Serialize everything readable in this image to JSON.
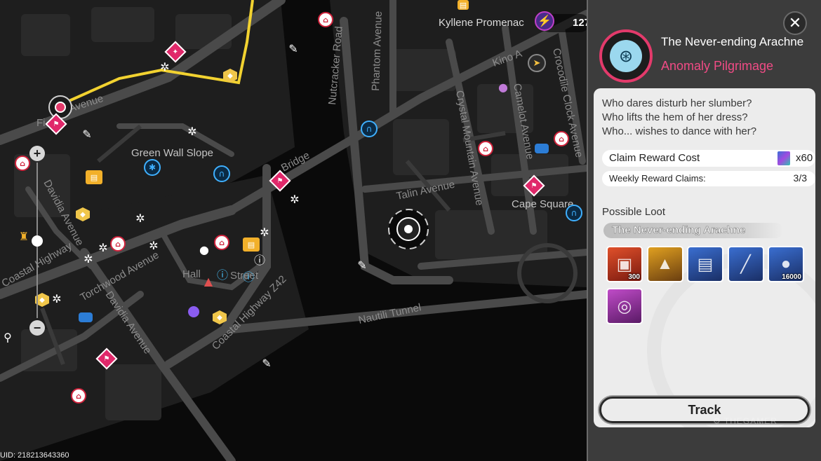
{
  "map": {
    "road_labels": [
      "Fi",
      "Avenue",
      "Nutcracker Road",
      "Phantom Avenue",
      "Kino A",
      "Camelot Avenue",
      "Crocodile Clock Avenue",
      "Crystal Mountain Avenue",
      "Bridge",
      "Talin Avenue",
      "Coastal Highway",
      "Davidia Avenue",
      "Torchwood Avenue",
      "Davidia Avenue",
      "Coastal Highway Z42",
      "Nautili Tunnel",
      "Hall",
      "Street"
    ],
    "area_labels": [
      "Green Wall Slope",
      "Cape Square"
    ],
    "place_label": "Kyllene Promenac",
    "energy_value": "127",
    "uid": "UID: 218213643360",
    "route_color": "#f2d230",
    "accent_color": "#e33a6b"
  },
  "panel": {
    "close_icon": "close-icon",
    "title": "The Never-ending Arachne",
    "subtitle": "Anomaly Pilgrimage",
    "flavor": [
      "Who dares disturb her slumber?",
      "Who lifts the hem of her dress?",
      "Who... wishes to dance with her?"
    ],
    "claim_cost_label": "Claim Reward Cost",
    "claim_cost_value": "x60",
    "weekly_label": "Weekly Reward Claims:",
    "weekly_value": "3/3",
    "possible_loot_label": "Possible Loot",
    "loot_source": "The Never-ending Arachne",
    "loot_items": [
      {
        "name": "hunter-mag-item",
        "quantity": "300",
        "colors": [
          "#e0502a",
          "#7a1a10"
        ]
      },
      {
        "name": "red-hood-item",
        "quantity": "",
        "colors": [
          "#e0a020",
          "#6a3e10"
        ]
      },
      {
        "name": "card-pack-item",
        "quantity": "",
        "colors": [
          "#3a6ed0",
          "#1a2f66"
        ]
      },
      {
        "name": "tube-item",
        "quantity": "",
        "colors": [
          "#3a6ed0",
          "#1a2f66"
        ]
      },
      {
        "name": "denny-coin-item",
        "quantity": "16000",
        "colors": [
          "#3a6ed0",
          "#1a2f66"
        ]
      },
      {
        "name": "drive-disc-item",
        "quantity": "",
        "colors": [
          "#c04cc8",
          "#5a1a66"
        ]
      }
    ],
    "track_label": "Track",
    "watermark": "THEGAMER"
  }
}
